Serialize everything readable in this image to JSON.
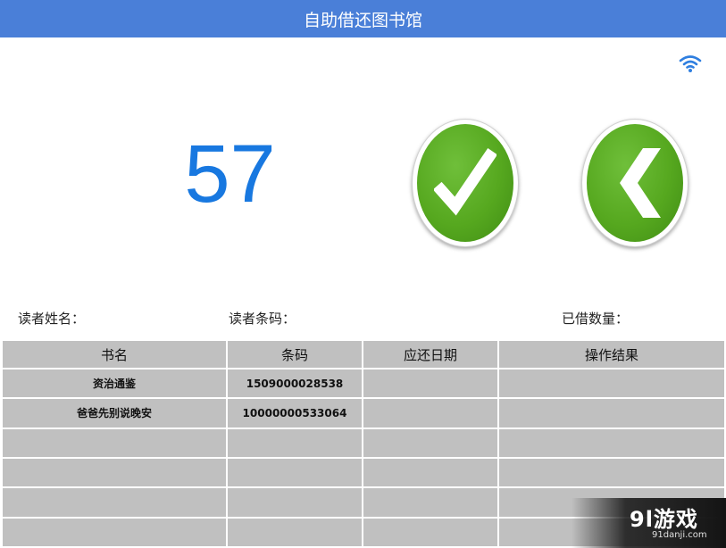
{
  "header": {
    "title": "自助借还图书馆"
  },
  "status": {
    "wifi_icon": "wifi-icon"
  },
  "main": {
    "countdown": "57",
    "confirm_icon": "check-icon",
    "back_icon": "chevron-left-icon",
    "accent_color": "#55a81e"
  },
  "reader": {
    "name_label": "读者姓名：",
    "barcode_label": "读者条码：",
    "borrowed_label": "已借数量："
  },
  "table": {
    "columns": [
      "书名",
      "条码",
      "应还日期",
      "操作结果"
    ],
    "rows": [
      [
        "资治通鉴",
        "1509000028538",
        "",
        ""
      ],
      [
        "爸爸先别说晚安",
        "10000000533064",
        "",
        ""
      ],
      [
        "",
        "",
        "",
        ""
      ],
      [
        "",
        "",
        "",
        ""
      ],
      [
        "",
        "",
        "",
        ""
      ],
      [
        "",
        "",
        "",
        ""
      ]
    ]
  },
  "watermark": {
    "logo": "9l游戏",
    "url": "91danji.com"
  }
}
